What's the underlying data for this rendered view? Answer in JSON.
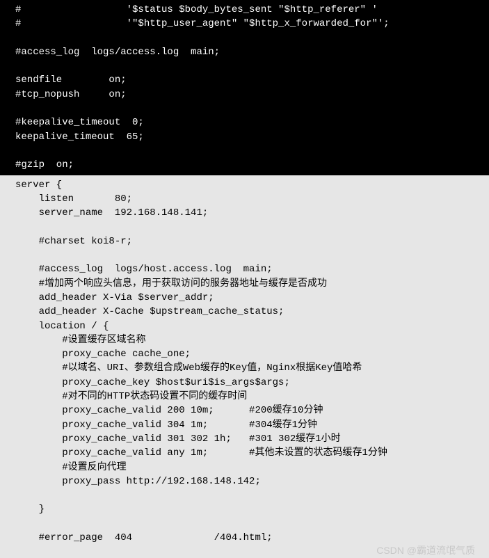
{
  "dark": {
    "lines": [
      "#                  '$status $body_bytes_sent \"$http_referer\" '",
      "#                  '\"$http_user_agent\" \"$http_x_forwarded_for\"';",
      "",
      "#access_log  logs/access.log  main;",
      "",
      "sendfile        on;",
      "#tcp_nopush     on;",
      "",
      "#keepalive_timeout  0;",
      "keepalive_timeout  65;",
      "",
      "#gzip  on;",
      ""
    ]
  },
  "light": {
    "lines": [
      "server {",
      "    listen       80;",
      "    server_name  192.168.148.141;",
      "",
      "    #charset koi8-r;",
      "",
      "    #access_log  logs/host.access.log  main;",
      "    #增加两个响应头信息，用于获取访问的服务器地址与缓存是否成功",
      "    add_header X-Via $server_addr;",
      "    add_header X-Cache $upstream_cache_status;",
      "    location / {",
      "        #设置缓存区域名称",
      "        proxy_cache cache_one;",
      "        #以域名、URI、参数组合成Web缓存的Key值，Nginx根据Key值哈希",
      "        proxy_cache_key $host$uri$is_args$args;",
      "        #对不同的HTTP状态码设置不同的缓存时间",
      "        proxy_cache_valid 200 10m;      #200缓存10分钟",
      "        proxy_cache_valid 304 1m;       #304缓存1分钟",
      "        proxy_cache_valid 301 302 1h;   #301 302缓存1小时",
      "        proxy_cache_valid any 1m;       #其他未设置的状态码缓存1分钟",
      "        #设置反向代理",
      "        proxy_pass http://192.168.148.142;",
      "",
      "    }",
      "",
      "    #error_page  404              /404.html;"
    ]
  },
  "watermark": "CSDN @霸道流氓气质"
}
